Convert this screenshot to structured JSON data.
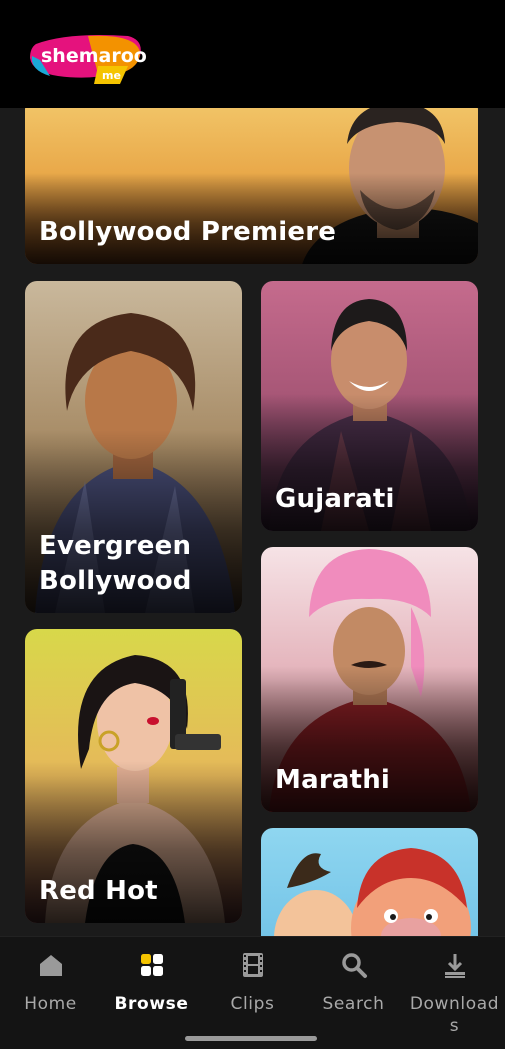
{
  "app": {
    "brand_name": "shemaroo",
    "brand_sub": "me",
    "brand_colors": {
      "pink": "#e5127d",
      "orange": "#f39200",
      "cyan": "#1aa9d6",
      "yellow": "#f5c400"
    }
  },
  "categories": [
    {
      "label": "Bollywood Premiere"
    },
    {
      "label": "Evergreen Bollywood"
    },
    {
      "label": "Gujarati"
    },
    {
      "label": "Marathi"
    },
    {
      "label": "Red Hot"
    },
    {
      "label": ""
    }
  ],
  "nav": {
    "items": [
      {
        "label": "Home",
        "icon": "home-icon",
        "active": false
      },
      {
        "label": "Browse",
        "icon": "grid-icon",
        "active": true
      },
      {
        "label": "Clips",
        "icon": "film-icon",
        "active": false
      },
      {
        "label": "Search",
        "icon": "search-icon",
        "active": false
      },
      {
        "label": "Downloads",
        "icon": "download-icon",
        "active": false
      }
    ]
  }
}
